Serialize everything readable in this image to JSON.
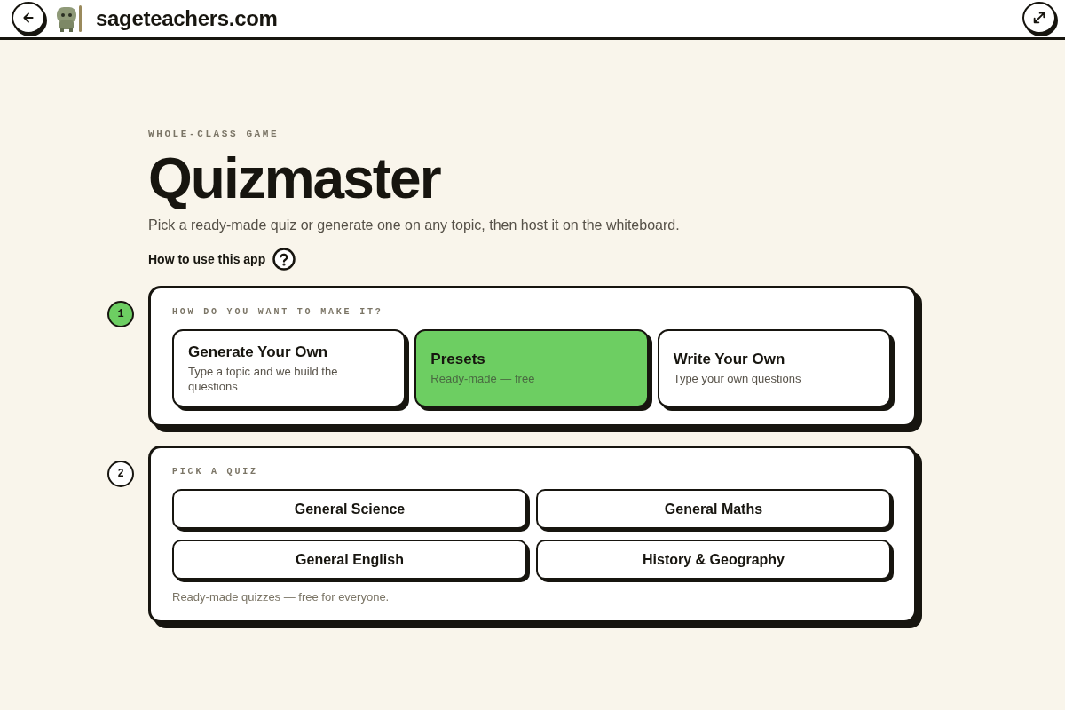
{
  "header": {
    "site": "sageteachers.com"
  },
  "intro": {
    "eyebrow": "WHOLE-CLASS GAME",
    "title": "Quizmaster",
    "subtitle": "Pick a ready-made quiz or generate one on any topic, then host it on the whiteboard.",
    "help_link": "How to use this app"
  },
  "steps": [
    {
      "number": "1",
      "active": true,
      "kind": "modes",
      "label": "HOW DO YOU WANT TO MAKE IT?",
      "options": [
        {
          "title": "Generate Your Own",
          "description": "Type a topic and we build the questions",
          "selected": false
        },
        {
          "title": "Presets",
          "description": "Ready-made — free",
          "selected": true
        },
        {
          "title": "Write Your Own",
          "description": "Type your own questions",
          "selected": false
        }
      ]
    },
    {
      "number": "2",
      "active": false,
      "kind": "quizzes",
      "label": "PICK A QUIZ",
      "quizzes": [
        "General Science",
        "General Maths",
        "General English",
        "History & Geography"
      ],
      "note": "Ready-made quizzes — free for everyone."
    }
  ]
}
